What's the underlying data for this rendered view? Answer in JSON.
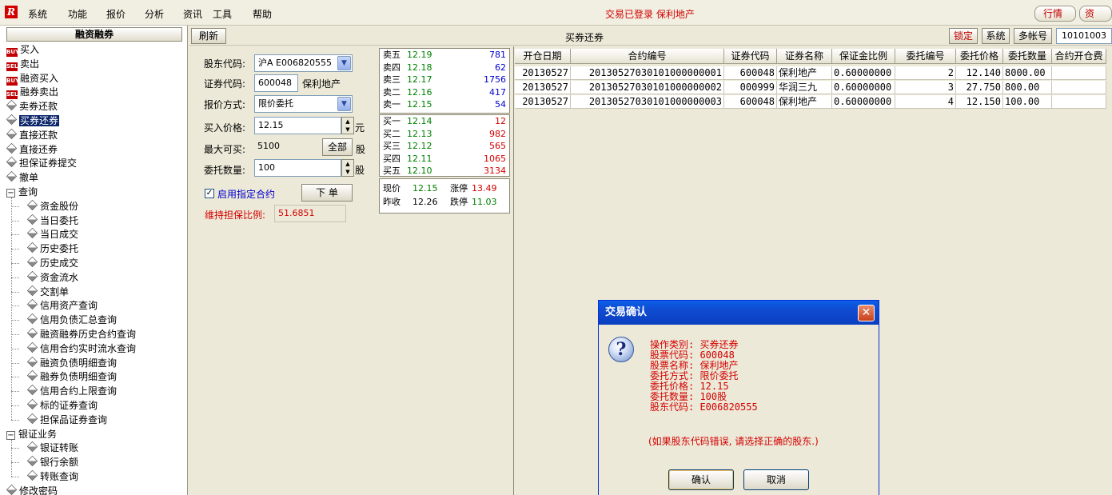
{
  "menubar": {
    "logo": "R",
    "items": [
      "系统",
      "功能",
      "报价",
      "分析",
      "资讯",
      "工具",
      "帮助"
    ],
    "login_status": "交易已登录  保利地产",
    "right_buttons": [
      "行情",
      "资"
    ]
  },
  "tree": {
    "title": "融资融券",
    "items": [
      {
        "label": "买入",
        "icon": "buy-icon"
      },
      {
        "label": "卖出",
        "icon": "sell-icon"
      },
      {
        "label": "融资买入",
        "icon": "buy-icon"
      },
      {
        "label": "融券卖出",
        "icon": "sell-icon"
      },
      {
        "label": "卖券还款",
        "icon": "diamond-icon"
      },
      {
        "label": "买券还券",
        "icon": "diamond-icon",
        "selected": true
      },
      {
        "label": "直接还款",
        "icon": "diamond-icon"
      },
      {
        "label": "直接还券",
        "icon": "diamond-icon"
      },
      {
        "label": "担保证券提交",
        "icon": "diamond-icon"
      },
      {
        "label": "撤单",
        "icon": "diamond-icon"
      },
      {
        "label": "查询",
        "icon": "collapse-box"
      },
      {
        "label": "资金股份",
        "icon": "diamond-icon",
        "child": true
      },
      {
        "label": "当日委托",
        "icon": "diamond-icon",
        "child": true
      },
      {
        "label": "当日成交",
        "icon": "diamond-icon",
        "child": true
      },
      {
        "label": "历史委托",
        "icon": "diamond-icon",
        "child": true
      },
      {
        "label": "历史成交",
        "icon": "diamond-icon",
        "child": true
      },
      {
        "label": "资金流水",
        "icon": "diamond-icon",
        "child": true
      },
      {
        "label": "交割单",
        "icon": "diamond-icon",
        "child": true
      },
      {
        "label": "信用资产查询",
        "icon": "diamond-icon",
        "child": true
      },
      {
        "label": "信用负债汇总查询",
        "icon": "diamond-icon",
        "child": true
      },
      {
        "label": "融资融券历史合约查询",
        "icon": "diamond-icon",
        "child": true
      },
      {
        "label": "信用合约实时流水查询",
        "icon": "diamond-icon",
        "child": true
      },
      {
        "label": "融资负债明细查询",
        "icon": "diamond-icon",
        "child": true
      },
      {
        "label": "融券负债明细查询",
        "icon": "diamond-icon",
        "child": true
      },
      {
        "label": "信用合约上限查询",
        "icon": "diamond-icon",
        "child": true
      },
      {
        "label": "标的证券查询",
        "icon": "diamond-icon",
        "child": true
      },
      {
        "label": "担保品证券查询",
        "icon": "diamond-icon",
        "child": true
      },
      {
        "label": "银证业务",
        "icon": "collapse-box"
      },
      {
        "label": "银证转账",
        "icon": "diamond-icon",
        "child": true
      },
      {
        "label": "银行余额",
        "icon": "diamond-icon",
        "child": true
      },
      {
        "label": "转账查询",
        "icon": "diamond-icon",
        "child": true
      },
      {
        "label": "修改密码",
        "icon": "diamond-icon"
      }
    ]
  },
  "toolbar": {
    "refresh": "刷新",
    "title": "买券还券",
    "lock": "锁定",
    "system": "系统",
    "multi_account": "多帐号",
    "account": "10101003"
  },
  "form": {
    "shareholder_label": "股东代码:",
    "shareholder_value": "沪A E006820555",
    "code_label": "证券代码:",
    "code_value": "600048",
    "stock_name": "保利地产",
    "order_type_label": "报价方式:",
    "order_type_value": "限价委托",
    "price_label": "买入价格:",
    "price_value": "12.15",
    "price_unit": "元",
    "max_label": "最大可买:",
    "max_value": "5100",
    "all_button": "全部",
    "max_unit": "股",
    "qty_label": "委托数量:",
    "qty_value": "100",
    "qty_unit": "股",
    "contract_check": "启用指定合约",
    "contract_checked": true,
    "submit": "下 单",
    "ratio_label": "维持担保比例:",
    "ratio_value": "51.6851"
  },
  "quote": {
    "asks": [
      {
        "name": "卖五",
        "price": "12.19",
        "vol": "781"
      },
      {
        "name": "卖四",
        "price": "12.18",
        "vol": "62"
      },
      {
        "name": "卖三",
        "price": "12.17",
        "vol": "1756"
      },
      {
        "name": "卖二",
        "price": "12.16",
        "vol": "417"
      },
      {
        "name": "卖一",
        "price": "12.15",
        "vol": "54"
      }
    ],
    "bids": [
      {
        "name": "买一",
        "price": "12.14",
        "vol": "12"
      },
      {
        "name": "买二",
        "price": "12.13",
        "vol": "982"
      },
      {
        "name": "买三",
        "price": "12.12",
        "vol": "565"
      },
      {
        "name": "买四",
        "price": "12.11",
        "vol": "1065"
      },
      {
        "name": "买五",
        "price": "12.10",
        "vol": "3134"
      }
    ],
    "last_label": "现价",
    "last": "12.15",
    "limit_up_label": "涨停",
    "limit_up": "13.49",
    "prev_label": "昨收",
    "prev": "12.26",
    "limit_down_label": "跌停",
    "limit_down": "11.03",
    "colors": {
      "price": "#008000",
      "ask_vol": "#0000cc",
      "bid_vol": "#d40000",
      "limit_up": "#d40000",
      "limit_down": "#008000"
    }
  },
  "table": {
    "headers": [
      "开仓日期",
      "合约编号",
      "证券代码",
      "证券名称",
      "保证金比例",
      "委托编号",
      "委托价格",
      "委托数量",
      "合约开仓费"
    ],
    "rows": [
      [
        "20130527",
        "20130527030101000000001",
        "600048",
        "保利地产",
        "0.60000000",
        "2",
        "12.140",
        "8000.00",
        ""
      ],
      [
        "20130527",
        "20130527030101000000002",
        "000999",
        "华润三九",
        "0.60000000",
        "3",
        "27.750",
        "800.00",
        ""
      ],
      [
        "20130527",
        "20130527030101000000003",
        "600048",
        "保利地产",
        "0.60000000",
        "4",
        "12.150",
        "100.00",
        ""
      ]
    ]
  },
  "dialog": {
    "title": "交易确认",
    "lines": [
      "操作类别: 买券还券",
      "股票代码: 600048",
      "股票名称: 保利地产",
      "委托方式: 限价委托",
      "委托价格: 12.15",
      "委托数量: 100股",
      "股东代码: E006820555"
    ],
    "note": "(如果股东代码错误, 请选择正确的股东.)",
    "ok": "确认",
    "cancel": "取消"
  }
}
